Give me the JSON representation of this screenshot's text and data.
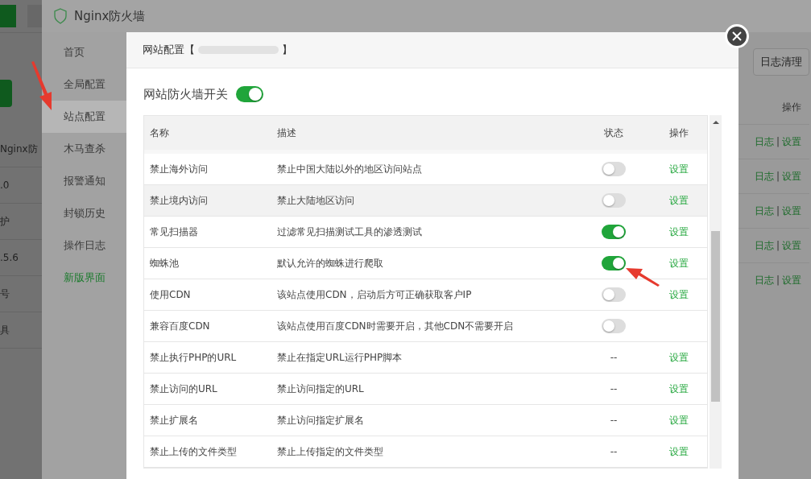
{
  "background_page": {
    "fragments": [
      "Nginx防",
      ".0",
      "护",
      ".5.6",
      "号",
      "具"
    ]
  },
  "plugin_window": {
    "title": "Nginx防火墙",
    "nav": [
      {
        "label": "首页",
        "selected": false,
        "kind": "item"
      },
      {
        "label": "全局配置",
        "selected": false,
        "kind": "item"
      },
      {
        "label": "站点配置",
        "selected": true,
        "kind": "item"
      },
      {
        "label": "木马查杀",
        "selected": false,
        "kind": "item"
      },
      {
        "label": "报警通知",
        "selected": false,
        "kind": "item"
      },
      {
        "label": "封锁历史",
        "selected": false,
        "kind": "item"
      },
      {
        "label": "操作日志",
        "selected": false,
        "kind": "item"
      },
      {
        "label": "新版界面",
        "selected": false,
        "kind": "link"
      }
    ],
    "clear_log_button": "日志清理",
    "table_header": "操作",
    "row_actions": [
      {
        "log": "日志",
        "sep": "|",
        "settings": "设置"
      },
      {
        "log": "日志",
        "sep": "|",
        "settings": "设置"
      },
      {
        "log": "日志",
        "sep": "|",
        "settings": "设置"
      },
      {
        "log": "日志",
        "sep": "|",
        "settings": "设置"
      },
      {
        "log": "日志",
        "sep": "|",
        "settings": "设置"
      }
    ]
  },
  "modal": {
    "title_prefix": "网站配置【",
    "title_suffix": "】",
    "firewall_switch": {
      "label": "网站防火墙开关",
      "on": true
    },
    "columns": [
      "名称",
      "描述",
      "状态",
      "操作"
    ],
    "rows": [
      {
        "name": "禁止海外访问",
        "description": "禁止中国大陆以外的地区访问站点",
        "kind": "toggle",
        "on": false,
        "action": "设置",
        "hover": false
      },
      {
        "name": "禁止境内访问",
        "description": "禁止大陆地区访问",
        "kind": "toggle",
        "on": false,
        "action": "设置",
        "hover": true
      },
      {
        "name": "常见扫描器",
        "description": "过滤常见扫描测试工具的渗透测试",
        "kind": "toggle",
        "on": true,
        "action": "设置",
        "hover": false
      },
      {
        "name": "蜘蛛池",
        "description": "默认允许的蜘蛛进行爬取",
        "kind": "toggle",
        "on": true,
        "action": "设置",
        "hover": false
      },
      {
        "name": "使用CDN",
        "description": "该站点使用CDN，启动后方可正确获取客户IP",
        "kind": "toggle",
        "on": false,
        "action": "设置",
        "hover": false
      },
      {
        "name": "兼容百度CDN",
        "description": "该站点使用百度CDN时需要开启，其他CDN不需要开启",
        "kind": "toggle",
        "on": false,
        "hover": false
      },
      {
        "name": "禁止执行PHP的URL",
        "description": "禁止在指定URL运行PHP脚本",
        "kind": "text",
        "status": "--",
        "action": "设置",
        "hover": false
      },
      {
        "name": "禁止访问的URL",
        "description": "禁止访问指定的URL",
        "kind": "text",
        "status": "--",
        "action": "设置",
        "hover": false
      },
      {
        "name": "禁止扩展名",
        "description": "禁止访问指定扩展名",
        "kind": "text",
        "status": "--",
        "action": "设置",
        "hover": false
      },
      {
        "name": "禁止上传的文件类型",
        "description": "禁止上传指定的文件类型",
        "kind": "text",
        "status": "--",
        "action": "设置",
        "hover": false
      }
    ]
  }
}
